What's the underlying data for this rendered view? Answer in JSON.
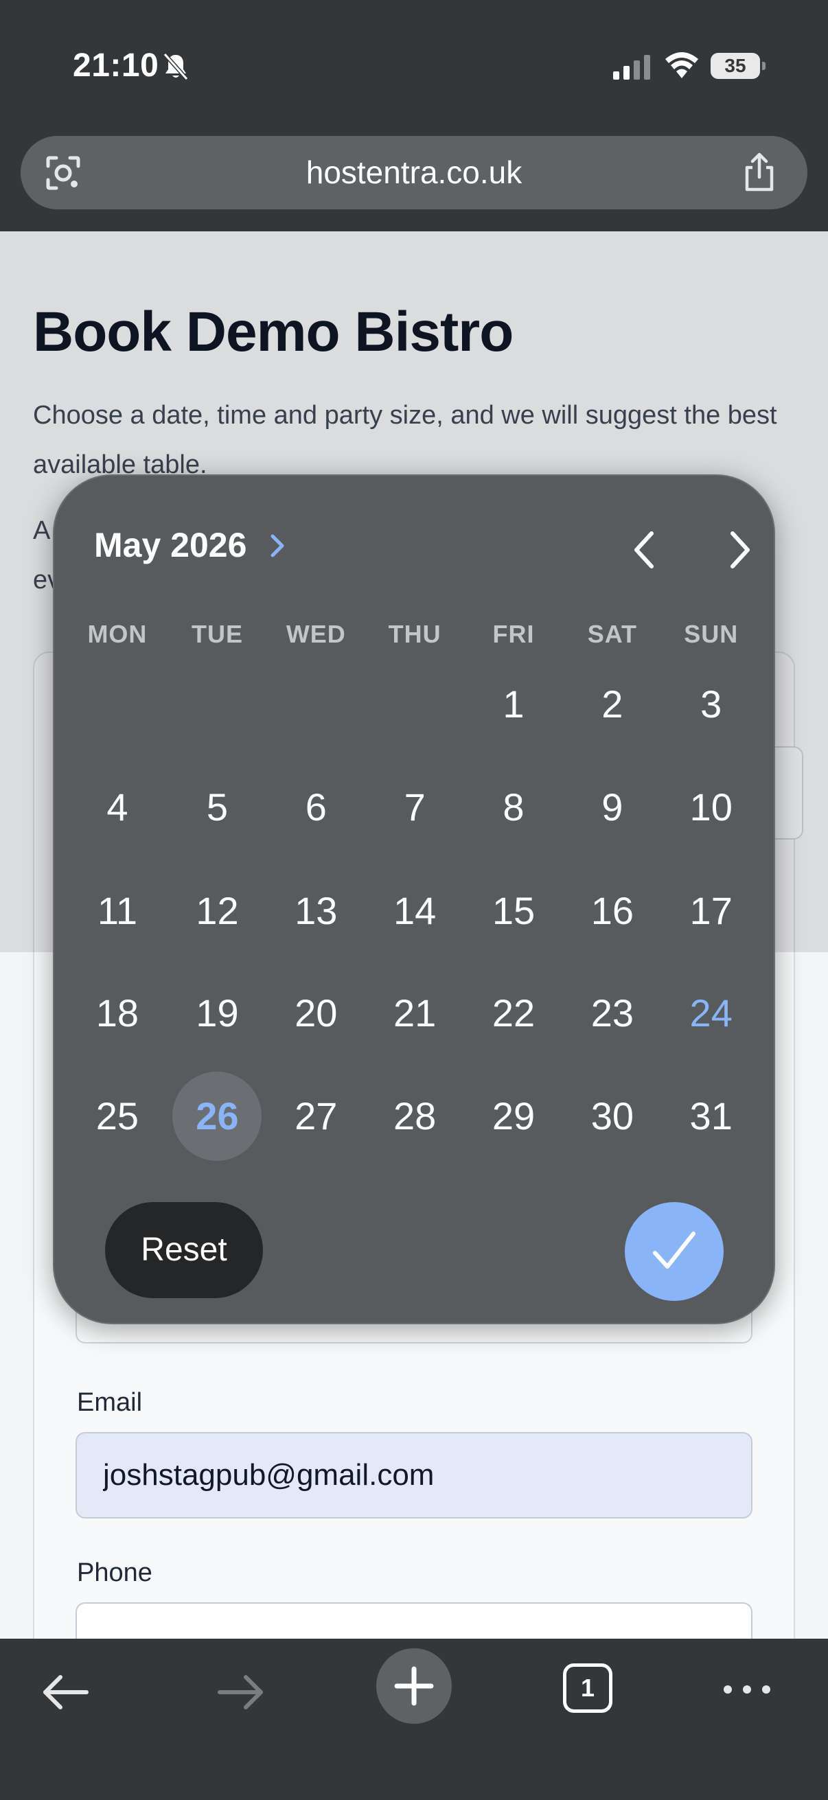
{
  "status_bar": {
    "time": "21:10",
    "battery": "35"
  },
  "url_bar": {
    "domain": "hostentra.co.uk"
  },
  "page": {
    "title": "Book Demo Bistro",
    "intro": "Choose a date, time and party size, and we will suggest the best available table.",
    "intro2_start": "A",
    "intro2_line2_start": "ev"
  },
  "form": {
    "email_label": "Email",
    "email_value": "joshstagpub@gmail.com",
    "phone_label": "Phone"
  },
  "calendar": {
    "month_label": "May 2026",
    "weekdays": [
      "MON",
      "TUE",
      "WED",
      "THU",
      "FRI",
      "SAT",
      "SUN"
    ],
    "days": [
      "1",
      "2",
      "3",
      "4",
      "5",
      "6",
      "7",
      "8",
      "9",
      "10",
      "11",
      "12",
      "13",
      "14",
      "15",
      "16",
      "17",
      "18",
      "19",
      "20",
      "21",
      "22",
      "23",
      "24",
      "25",
      "26",
      "27",
      "28",
      "29",
      "30",
      "31"
    ],
    "today": "24",
    "selected": "26",
    "reset_label": "Reset",
    "accent": "#8ab4f8"
  },
  "toolbar": {
    "tab_count": "1"
  },
  "icons": [
    "bell-off-icon",
    "signal-icon",
    "wifi-icon",
    "battery-icon",
    "lens-icon",
    "share-icon",
    "chevron-right-icon",
    "chevron-left-icon",
    "checkmark-icon",
    "back-arrow-icon",
    "forward-arrow-icon",
    "plus-icon",
    "tabs-icon",
    "more-icon"
  ]
}
